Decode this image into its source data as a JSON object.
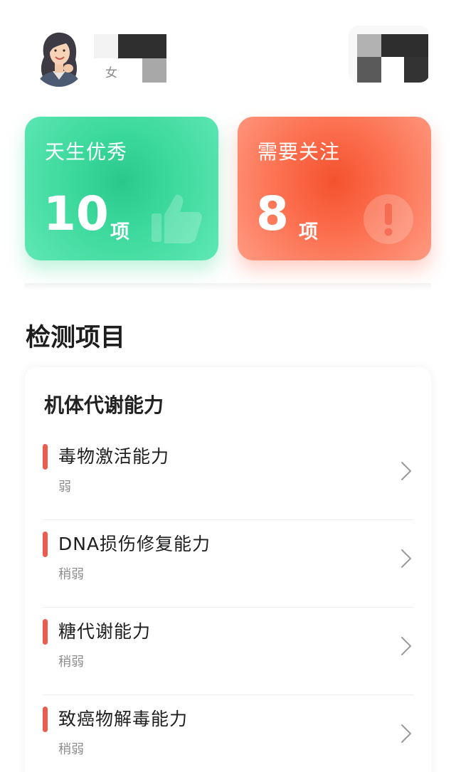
{
  "profile": {
    "gender": "女"
  },
  "summary": {
    "good": {
      "title": "天生优秀",
      "count": "10",
      "unit": "项",
      "color": "#39d79a",
      "icon": "thumbs-up-icon"
    },
    "warn": {
      "title": "需要关注",
      "count": "8",
      "unit": "项",
      "color": "#fb6b4a",
      "icon": "exclamation-icon"
    }
  },
  "section": {
    "title": "检测项目"
  },
  "panel": {
    "title": "机体代谢能力",
    "items": [
      {
        "label": "毒物激活能力",
        "level": "弱"
      },
      {
        "label": "DNA损伤修复能力",
        "level": "稍弱"
      },
      {
        "label": "糖代谢能力",
        "level": "稍弱"
      },
      {
        "label": "致癌物解毒能力",
        "level": "稍弱"
      }
    ]
  },
  "colors": {
    "accent_bar": "#ec5c4c",
    "good_card": "#39d79a",
    "warn_card": "#fb6b4a"
  }
}
